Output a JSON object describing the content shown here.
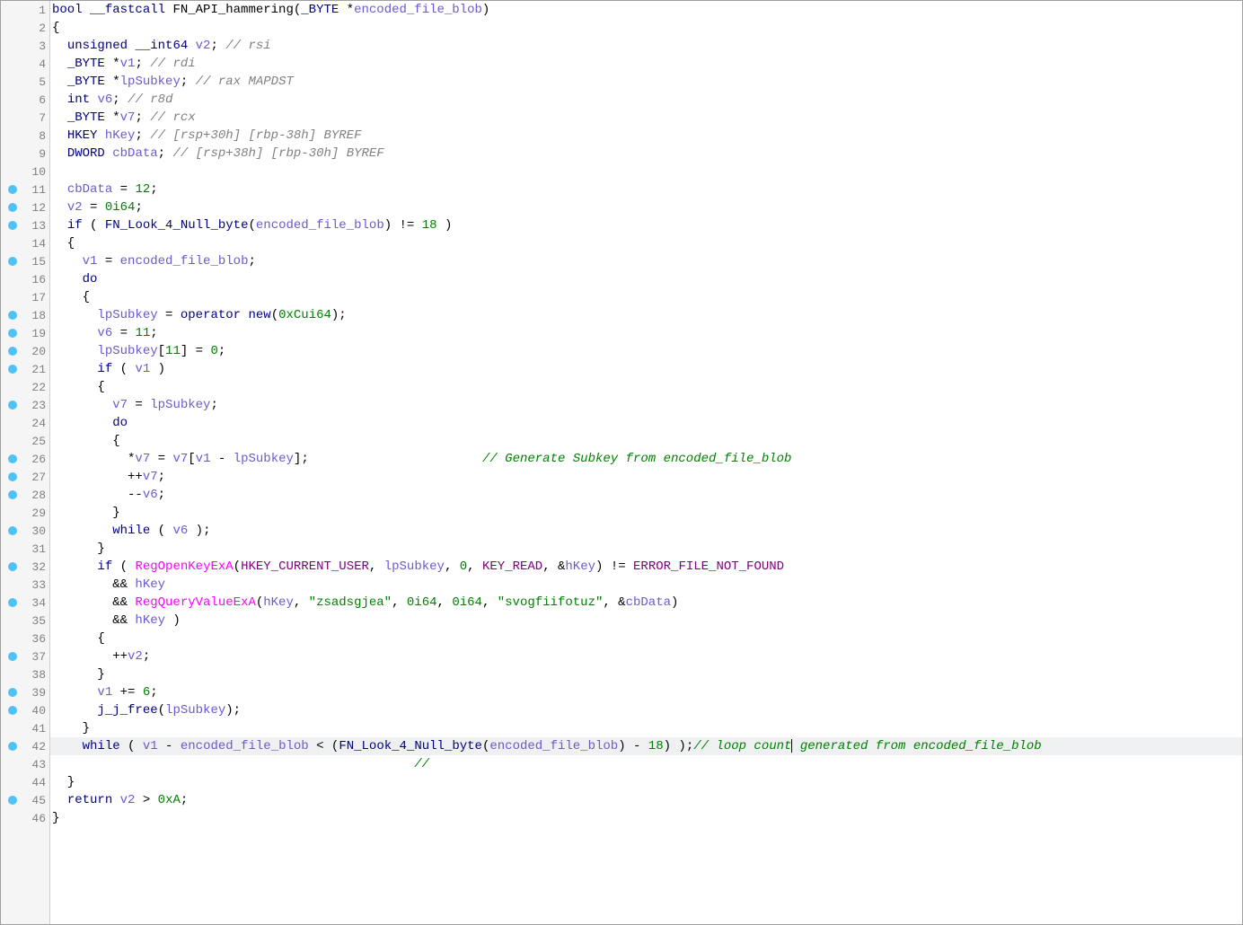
{
  "line_count": 46,
  "breakpoints": [
    11,
    12,
    13,
    15,
    18,
    19,
    20,
    21,
    23,
    26,
    27,
    28,
    30,
    32,
    34,
    37,
    39,
    40,
    42,
    45
  ],
  "highlighted_line": 42,
  "cursor_line": 42,
  "code": [
    {
      "n": 1,
      "tokens": [
        {
          "t": "bool",
          "c": "kw"
        },
        {
          "t": " ",
          "c": ""
        },
        {
          "t": "__fastcall",
          "c": "kw"
        },
        {
          "t": " ",
          "c": ""
        },
        {
          "t": "FN_API_hammering",
          "c": "ident"
        },
        {
          "t": "(",
          "c": "paren"
        },
        {
          "t": "_BYTE",
          "c": "type"
        },
        {
          "t": " *",
          "c": "op"
        },
        {
          "t": "encoded_file_blob",
          "c": "var-blue"
        },
        {
          "t": ")",
          "c": "paren"
        }
      ]
    },
    {
      "n": 2,
      "tokens": [
        {
          "t": "{",
          "c": "punct"
        }
      ]
    },
    {
      "n": 3,
      "tokens": [
        {
          "t": "  ",
          "c": ""
        },
        {
          "t": "unsigned",
          "c": "kw"
        },
        {
          "t": " ",
          "c": ""
        },
        {
          "t": "__int64",
          "c": "kw"
        },
        {
          "t": " ",
          "c": ""
        },
        {
          "t": "v2",
          "c": "var-blue"
        },
        {
          "t": ";",
          "c": "punct"
        },
        {
          "t": " ",
          "c": ""
        },
        {
          "t": "// rsi",
          "c": "comment"
        }
      ]
    },
    {
      "n": 4,
      "tokens": [
        {
          "t": "  ",
          "c": ""
        },
        {
          "t": "_BYTE",
          "c": "type"
        },
        {
          "t": " *",
          "c": "op"
        },
        {
          "t": "v1",
          "c": "var-blue"
        },
        {
          "t": ";",
          "c": "punct"
        },
        {
          "t": " ",
          "c": ""
        },
        {
          "t": "// rdi",
          "c": "comment"
        }
      ]
    },
    {
      "n": 5,
      "tokens": [
        {
          "t": "  ",
          "c": ""
        },
        {
          "t": "_BYTE",
          "c": "type"
        },
        {
          "t": " *",
          "c": "op"
        },
        {
          "t": "lpSubkey",
          "c": "var-blue"
        },
        {
          "t": ";",
          "c": "punct"
        },
        {
          "t": " ",
          "c": ""
        },
        {
          "t": "// rax MAPDST",
          "c": "comment"
        }
      ]
    },
    {
      "n": 6,
      "tokens": [
        {
          "t": "  ",
          "c": ""
        },
        {
          "t": "int",
          "c": "kw"
        },
        {
          "t": " ",
          "c": ""
        },
        {
          "t": "v6",
          "c": "var-blue"
        },
        {
          "t": ";",
          "c": "punct"
        },
        {
          "t": " ",
          "c": ""
        },
        {
          "t": "// r8d",
          "c": "comment"
        }
      ]
    },
    {
      "n": 7,
      "tokens": [
        {
          "t": "  ",
          "c": ""
        },
        {
          "t": "_BYTE",
          "c": "type"
        },
        {
          "t": " *",
          "c": "op"
        },
        {
          "t": "v7",
          "c": "var-blue"
        },
        {
          "t": ";",
          "c": "punct"
        },
        {
          "t": " ",
          "c": ""
        },
        {
          "t": "// rcx",
          "c": "comment"
        }
      ]
    },
    {
      "n": 8,
      "tokens": [
        {
          "t": "  ",
          "c": ""
        },
        {
          "t": "HKEY",
          "c": "type"
        },
        {
          "t": " ",
          "c": ""
        },
        {
          "t": "hKey",
          "c": "var-blue"
        },
        {
          "t": ";",
          "c": "punct"
        },
        {
          "t": " ",
          "c": ""
        },
        {
          "t": "// [rsp+30h] [rbp-38h] BYREF",
          "c": "comment"
        }
      ]
    },
    {
      "n": 9,
      "tokens": [
        {
          "t": "  ",
          "c": ""
        },
        {
          "t": "DWORD",
          "c": "type"
        },
        {
          "t": " ",
          "c": ""
        },
        {
          "t": "cbData",
          "c": "var-blue"
        },
        {
          "t": ";",
          "c": "punct"
        },
        {
          "t": " ",
          "c": ""
        },
        {
          "t": "// [rsp+38h] [rbp-30h] BYREF",
          "c": "comment"
        }
      ]
    },
    {
      "n": 10,
      "tokens": []
    },
    {
      "n": 11,
      "tokens": [
        {
          "t": "  ",
          "c": ""
        },
        {
          "t": "cbData",
          "c": "var-blue"
        },
        {
          "t": " = ",
          "c": "op"
        },
        {
          "t": "12",
          "c": "num"
        },
        {
          "t": ";",
          "c": "punct"
        }
      ]
    },
    {
      "n": 12,
      "tokens": [
        {
          "t": "  ",
          "c": ""
        },
        {
          "t": "v2",
          "c": "var-blue"
        },
        {
          "t": " = ",
          "c": "op"
        },
        {
          "t": "0i64",
          "c": "num"
        },
        {
          "t": ";",
          "c": "punct"
        }
      ]
    },
    {
      "n": 13,
      "tokens": [
        {
          "t": "  ",
          "c": ""
        },
        {
          "t": "if",
          "c": "kw"
        },
        {
          "t": " ( ",
          "c": "paren"
        },
        {
          "t": "FN_Look_4_Null_byte",
          "c": "func-navy"
        },
        {
          "t": "(",
          "c": "paren"
        },
        {
          "t": "encoded_file_blob",
          "c": "var-blue"
        },
        {
          "t": ") != ",
          "c": "op"
        },
        {
          "t": "18",
          "c": "num"
        },
        {
          "t": " )",
          "c": "paren"
        }
      ]
    },
    {
      "n": 14,
      "tokens": [
        {
          "t": "  {",
          "c": "punct"
        }
      ]
    },
    {
      "n": 15,
      "tokens": [
        {
          "t": "    ",
          "c": ""
        },
        {
          "t": "v1",
          "c": "var-blue"
        },
        {
          "t": " = ",
          "c": "op"
        },
        {
          "t": "encoded_file_blob",
          "c": "var-blue"
        },
        {
          "t": ";",
          "c": "punct"
        }
      ]
    },
    {
      "n": 16,
      "tokens": [
        {
          "t": "    ",
          "c": ""
        },
        {
          "t": "do",
          "c": "kw"
        }
      ]
    },
    {
      "n": 17,
      "tokens": [
        {
          "t": "    {",
          "c": "punct"
        }
      ]
    },
    {
      "n": 18,
      "tokens": [
        {
          "t": "      ",
          "c": ""
        },
        {
          "t": "lpSubkey",
          "c": "var-blue"
        },
        {
          "t": " = ",
          "c": "op"
        },
        {
          "t": "operator new",
          "c": "func-navy"
        },
        {
          "t": "(",
          "c": "paren"
        },
        {
          "t": "0xCui64",
          "c": "num"
        },
        {
          "t": ");",
          "c": "paren"
        }
      ]
    },
    {
      "n": 19,
      "tokens": [
        {
          "t": "      ",
          "c": ""
        },
        {
          "t": "v6",
          "c": "var-blue"
        },
        {
          "t": " = ",
          "c": "op"
        },
        {
          "t": "11",
          "c": "num"
        },
        {
          "t": ";",
          "c": "punct"
        }
      ]
    },
    {
      "n": 20,
      "tokens": [
        {
          "t": "      ",
          "c": ""
        },
        {
          "t": "lpSubkey",
          "c": "var-blue"
        },
        {
          "t": "[",
          "c": "op"
        },
        {
          "t": "11",
          "c": "num"
        },
        {
          "t": "] = ",
          "c": "op"
        },
        {
          "t": "0",
          "c": "num"
        },
        {
          "t": ";",
          "c": "punct"
        }
      ]
    },
    {
      "n": 21,
      "tokens": [
        {
          "t": "      ",
          "c": ""
        },
        {
          "t": "if",
          "c": "kw"
        },
        {
          "t": " ( ",
          "c": "paren"
        },
        {
          "t": "v1",
          "c": "var-blue"
        },
        {
          "t": " )",
          "c": "paren"
        }
      ]
    },
    {
      "n": 22,
      "tokens": [
        {
          "t": "      {",
          "c": "punct"
        }
      ]
    },
    {
      "n": 23,
      "tokens": [
        {
          "t": "        ",
          "c": ""
        },
        {
          "t": "v7",
          "c": "var-blue"
        },
        {
          "t": " = ",
          "c": "op"
        },
        {
          "t": "lpSubkey",
          "c": "var-blue"
        },
        {
          "t": ";",
          "c": "punct"
        }
      ]
    },
    {
      "n": 24,
      "tokens": [
        {
          "t": "        ",
          "c": ""
        },
        {
          "t": "do",
          "c": "kw"
        }
      ]
    },
    {
      "n": 25,
      "tokens": [
        {
          "t": "        {",
          "c": "punct"
        }
      ]
    },
    {
      "n": 26,
      "tokens": [
        {
          "t": "          *",
          "c": "op"
        },
        {
          "t": "v7",
          "c": "var-blue"
        },
        {
          "t": " = ",
          "c": "op"
        },
        {
          "t": "v7",
          "c": "var-blue"
        },
        {
          "t": "[",
          "c": "op"
        },
        {
          "t": "v1",
          "c": "var-blue"
        },
        {
          "t": " - ",
          "c": "op"
        },
        {
          "t": "lpSubkey",
          "c": "var-blue"
        },
        {
          "t": "];",
          "c": "op"
        },
        {
          "t": "                       ",
          "c": ""
        },
        {
          "t": "// Generate Subkey from encoded_file_blob",
          "c": "comment-green"
        }
      ]
    },
    {
      "n": 27,
      "tokens": [
        {
          "t": "          ++",
          "c": "op"
        },
        {
          "t": "v7",
          "c": "var-blue"
        },
        {
          "t": ";",
          "c": "punct"
        }
      ]
    },
    {
      "n": 28,
      "tokens": [
        {
          "t": "          --",
          "c": "op"
        },
        {
          "t": "v6",
          "c": "var-blue"
        },
        {
          "t": ";",
          "c": "punct"
        }
      ]
    },
    {
      "n": 29,
      "tokens": [
        {
          "t": "        }",
          "c": "punct"
        }
      ]
    },
    {
      "n": 30,
      "tokens": [
        {
          "t": "        ",
          "c": ""
        },
        {
          "t": "while",
          "c": "kw"
        },
        {
          "t": " ( ",
          "c": "paren"
        },
        {
          "t": "v6",
          "c": "var-blue"
        },
        {
          "t": " );",
          "c": "paren"
        }
      ]
    },
    {
      "n": 31,
      "tokens": [
        {
          "t": "      }",
          "c": "punct"
        }
      ]
    },
    {
      "n": 32,
      "tokens": [
        {
          "t": "      ",
          "c": ""
        },
        {
          "t": "if",
          "c": "kw"
        },
        {
          "t": " ( ",
          "c": "paren"
        },
        {
          "t": "RegOpenKeyExA",
          "c": "func-magenta"
        },
        {
          "t": "(",
          "c": "paren"
        },
        {
          "t": "HKEY_CURRENT_USER",
          "c": "const-purple"
        },
        {
          "t": ", ",
          "c": "punct"
        },
        {
          "t": "lpSubkey",
          "c": "var-blue"
        },
        {
          "t": ", ",
          "c": "punct"
        },
        {
          "t": "0",
          "c": "num"
        },
        {
          "t": ", ",
          "c": "punct"
        },
        {
          "t": "KEY_READ",
          "c": "const-purple"
        },
        {
          "t": ", &",
          "c": "op"
        },
        {
          "t": "hKey",
          "c": "var-blue"
        },
        {
          "t": ") != ",
          "c": "op"
        },
        {
          "t": "ERROR_FILE_NOT_FOUND",
          "c": "const-purple"
        }
      ]
    },
    {
      "n": 33,
      "tokens": [
        {
          "t": "        && ",
          "c": "op"
        },
        {
          "t": "hKey",
          "c": "var-blue"
        }
      ]
    },
    {
      "n": 34,
      "tokens": [
        {
          "t": "        && ",
          "c": "op"
        },
        {
          "t": "RegQueryValueExA",
          "c": "func-magenta"
        },
        {
          "t": "(",
          "c": "paren"
        },
        {
          "t": "hKey",
          "c": "var-blue"
        },
        {
          "t": ", ",
          "c": "punct"
        },
        {
          "t": "\"zsadsgjea\"",
          "c": "str"
        },
        {
          "t": ", ",
          "c": "punct"
        },
        {
          "t": "0i64",
          "c": "num"
        },
        {
          "t": ", ",
          "c": "punct"
        },
        {
          "t": "0i64",
          "c": "num"
        },
        {
          "t": ", ",
          "c": "punct"
        },
        {
          "t": "\"svogfiifotuz\"",
          "c": "str"
        },
        {
          "t": ", &",
          "c": "op"
        },
        {
          "t": "cbData",
          "c": "var-blue"
        },
        {
          "t": ")",
          "c": "paren"
        }
      ]
    },
    {
      "n": 35,
      "tokens": [
        {
          "t": "        && ",
          "c": "op"
        },
        {
          "t": "hKey",
          "c": "var-blue"
        },
        {
          "t": " )",
          "c": "paren"
        }
      ]
    },
    {
      "n": 36,
      "tokens": [
        {
          "t": "      {",
          "c": "punct"
        }
      ]
    },
    {
      "n": 37,
      "tokens": [
        {
          "t": "        ++",
          "c": "op"
        },
        {
          "t": "v2",
          "c": "var-blue"
        },
        {
          "t": ";",
          "c": "punct"
        }
      ]
    },
    {
      "n": 38,
      "tokens": [
        {
          "t": "      }",
          "c": "punct"
        }
      ]
    },
    {
      "n": 39,
      "tokens": [
        {
          "t": "      ",
          "c": ""
        },
        {
          "t": "v1",
          "c": "var-blue"
        },
        {
          "t": " += ",
          "c": "op"
        },
        {
          "t": "6",
          "c": "num"
        },
        {
          "t": ";",
          "c": "punct"
        }
      ]
    },
    {
      "n": 40,
      "tokens": [
        {
          "t": "      ",
          "c": ""
        },
        {
          "t": "j_j_free",
          "c": "func-navy"
        },
        {
          "t": "(",
          "c": "paren"
        },
        {
          "t": "lpSubkey",
          "c": "var-blue"
        },
        {
          "t": ");",
          "c": "paren"
        }
      ]
    },
    {
      "n": 41,
      "tokens": [
        {
          "t": "    }",
          "c": "punct"
        }
      ]
    },
    {
      "n": 42,
      "tokens": [
        {
          "t": "    ",
          "c": ""
        },
        {
          "t": "while",
          "c": "kw"
        },
        {
          "t": " ( ",
          "c": "paren"
        },
        {
          "t": "v1",
          "c": "var-blue"
        },
        {
          "t": " - ",
          "c": "op"
        },
        {
          "t": "encoded_file_blob",
          "c": "var-blue"
        },
        {
          "t": " < (",
          "c": "op"
        },
        {
          "t": "FN_Look_4_Null_byte",
          "c": "func-navy"
        },
        {
          "t": "(",
          "c": "paren"
        },
        {
          "t": "encoded_file_blob",
          "c": "var-blue"
        },
        {
          "t": ") - ",
          "c": "op"
        },
        {
          "t": "18",
          "c": "num"
        },
        {
          "t": ") );",
          "c": "paren"
        },
        {
          "t": "// loop count",
          "c": "comment-green"
        },
        {
          "cursor": true
        },
        {
          "t": " generated from encoded_file_blob",
          "c": "comment-green"
        }
      ]
    },
    {
      "n": 43,
      "tokens": [
        {
          "t": "                                                ",
          "c": ""
        },
        {
          "t": "// ",
          "c": "comment-green"
        }
      ]
    },
    {
      "n": 44,
      "tokens": [
        {
          "t": "  }",
          "c": "punct"
        }
      ]
    },
    {
      "n": 45,
      "tokens": [
        {
          "t": "  ",
          "c": ""
        },
        {
          "t": "return",
          "c": "kw"
        },
        {
          "t": " ",
          "c": ""
        },
        {
          "t": "v2",
          "c": "var-blue"
        },
        {
          "t": " > ",
          "c": "op"
        },
        {
          "t": "0xA",
          "c": "num"
        },
        {
          "t": ";",
          "c": "punct"
        }
      ]
    },
    {
      "n": 46,
      "tokens": [
        {
          "t": "}",
          "c": "punct"
        }
      ]
    }
  ]
}
